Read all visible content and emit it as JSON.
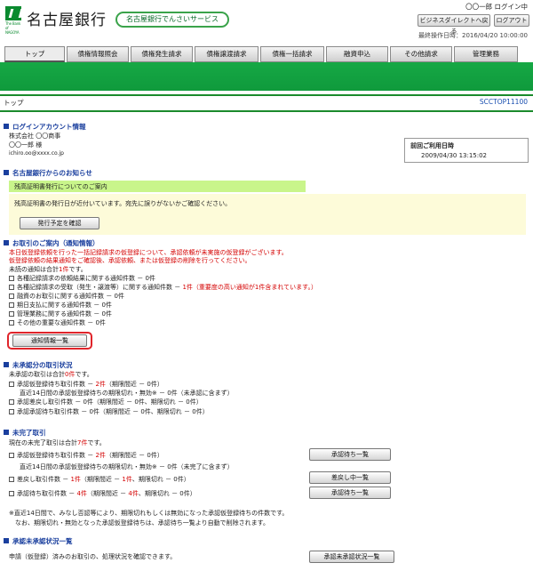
{
  "header": {
    "bank_name": "名古屋銀行",
    "logo_sub": "The Bank of NAGOYA",
    "service_name": "名古屋銀行でんさいサービス",
    "user_login": "〇〇一郎 ログイン中",
    "direct_button": "ビジネスダイレクトへ戻る",
    "logout_button": "ログアウト",
    "last_operation": "最終操作日時：2016/04/20 10:00:00"
  },
  "tabs": [
    "トップ",
    "債権情報照会",
    "債権発生請求",
    "債権譲渡請求",
    "債権一括請求",
    "融資申込",
    "その他請求",
    "管理業務"
  ],
  "page": {
    "title": "トップ",
    "screen_id": "SCCTOP11100"
  },
  "login_account": {
    "heading": "ログインアカウント情報",
    "company": "株式会社 〇〇商事",
    "user": "〇〇一郎 様",
    "email": "ichiro.oo@xxxx.co.jp",
    "last_login_label": "前回ご利用日時",
    "last_login_value": "2009/04/30 13:15:02"
  },
  "news": {
    "heading": "名古屋銀行からのお知らせ",
    "title": "残高証明書発行についてのご案内",
    "body": "残高証明書の発行日が近付いています。宛先に誤りがないかご確認ください。",
    "button": "発行予定を確認"
  },
  "notifications": {
    "heading": "お取引のご案内（通知情報）",
    "alert1": "本日仮登録依頼を行った一括記録請求の仮登録について、承認依頼が未実施の仮登録がございます。",
    "alert2": "仮登録依頼の結果通知をご確認後、承認依頼、または仮登録の削除を行ってください。",
    "unread_prefix": "未読の通知は合計",
    "unread_count": "1件",
    "unread_suffix": "です。",
    "items": [
      {
        "label": "各種記録請求の依頼結果に関する通知件数",
        "sep": " － ",
        "count": "0件",
        "note": "",
        "red": false
      },
      {
        "label": "各種記録請求の受取（発生・譲渡等）に関する通知件数",
        "sep": " － ",
        "count": "1件",
        "note": "（重要度の高い通知が1件含まれています。）",
        "red": true
      },
      {
        "label": "融資のお取引に関する通知件数",
        "sep": " － ",
        "count": "0件",
        "note": "",
        "red": false
      },
      {
        "label": "期日支払に関する通知件数",
        "sep": " － ",
        "count": "0件",
        "note": "",
        "red": false
      },
      {
        "label": "管理業務に関する通知件数",
        "sep": " － ",
        "count": "0件",
        "note": "",
        "red": false
      },
      {
        "label": "その他の重要な通知件数",
        "sep": " － ",
        "count": "0件",
        "note": "",
        "red": false
      }
    ],
    "button": "通知情報一覧"
  },
  "unapproved": {
    "heading": "未承認分の取引状況",
    "summary_prefix": "未承認の取引は合計",
    "summary_count": "0件",
    "summary_suffix": "です。",
    "line1a": "承認仮登録待ち取引件数 － ",
    "line1b": "2件",
    "line1c": "（期限間近 － 0件）",
    "line2": "直近14日間の承認仮登録待ちの期限切れ・無効※ － 0件（未承認に含まず）",
    "line3": "承認差戻し取引件数 － 0件（期限間近 － 0件、期限切れ － 0件）",
    "line4": "承認承認待ち取引件数 － 0件（期限間近 － 0件、期限切れ － 0件）"
  },
  "incomplete": {
    "heading": "未完了取引",
    "summary_prefix": "現在の未完了取引は合計",
    "summary_count": "7件",
    "summary_suffix": "です。",
    "line1a": "承認仮登録待ち取引件数 － ",
    "line1b": "2件",
    "line1c": "（期限間近 － 0件）",
    "line2": "直近14日間の承認仮登録待ちの期限切れ・無効※ － 0件（未完了に含まず）",
    "line3a": "差戻し取引件数 － ",
    "line3b": "1件",
    "line3c": "（期限間近 － ",
    "line3d": "1件",
    "line3e": "、期限切れ － 0件）",
    "line4a": "承認待ち取引件数 － ",
    "line4b": "4件",
    "line4c": "（期限間近 － ",
    "line4d": "4件",
    "line4e": "、期限切れ － 0件）",
    "btn1": "承認待ち一覧",
    "btn2": "差戻し中一覧",
    "btn3": "承認待ち一覧",
    "footnote1": "※直近14日間で、みなし否認等により、期限切れもしくは無効になった承認仮登録待ちの件数です。",
    "footnote2": "　なお、期限切れ・無効となった承認仮登録待ちは、承認待ち一覧より自動で削除されます。"
  },
  "status_list": {
    "heading": "承認未承認状況一覧",
    "text": "申請（仮登録）済みのお取引の、処理状況を確認できます。",
    "button": "承認未承認状況一覧"
  }
}
